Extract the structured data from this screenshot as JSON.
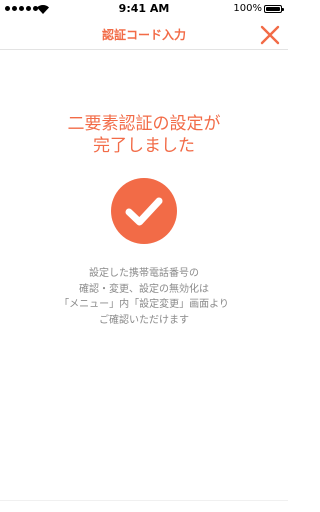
{
  "status_bar": {
    "time": "9:41 AM",
    "battery_percent": "100%",
    "icons": [
      "signal-dots-icon",
      "wifi-icon",
      "battery-icon"
    ]
  },
  "header": {
    "title": "認証コード入力",
    "close_icon": "close-x-icon"
  },
  "main": {
    "headline_line1": "二要素認証の設定が",
    "headline_line2": "完了しました",
    "success_icon": "check-circle-icon",
    "message_lines": [
      "設定した携帯電話番号の",
      "確認・変更、設定の無効化は",
      "「メニュー」内「設定変更」画面より",
      "ご確認いただけます"
    ]
  },
  "colors": {
    "accent": "#f26b47",
    "muted_text": "#8a8a8a",
    "divider": "#e3e3e3"
  }
}
